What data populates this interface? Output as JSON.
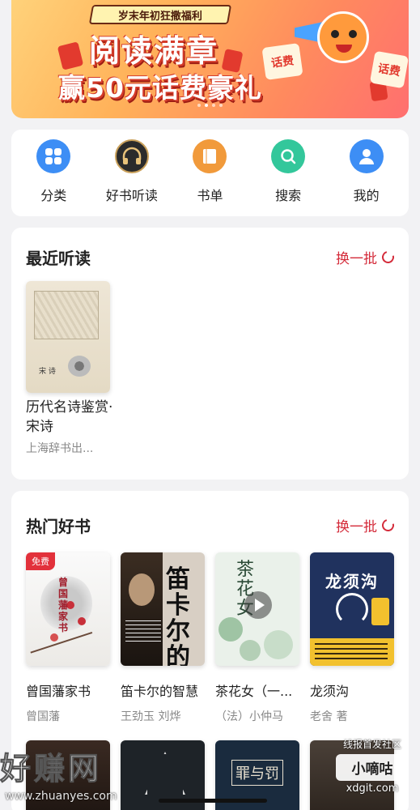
{
  "banner": {
    "ribbon": "岁末年初狂撒福利",
    "title_line1": "阅读满章",
    "title_line2": "赢50元话费豪礼",
    "card_left": "话费",
    "card_right": "话费"
  },
  "nav": [
    {
      "label": "分类",
      "icon": "grid-icon"
    },
    {
      "label": "好书听读",
      "icon": "headphones-icon"
    },
    {
      "label": "书单",
      "icon": "book-icon"
    },
    {
      "label": "搜索",
      "icon": "search-icon"
    },
    {
      "label": "我的",
      "icon": "user-icon"
    }
  ],
  "recent": {
    "title": "最近听读",
    "refresh": "换一批",
    "book": {
      "name": "历代名诗鉴赏·宋诗",
      "publisher": "上海辞书出...",
      "cover_text": "宋 诗"
    }
  },
  "hot": {
    "title": "热门好书",
    "refresh": "换一批",
    "free_badge": "免费",
    "books": [
      {
        "title": "曾国藩家书",
        "author": "曾国藩",
        "cover_text": "曾国藩家书"
      },
      {
        "title": "笛卡尔的智慧",
        "author": "王劲玉 刘烨",
        "cover_text": "笛卡尔的智慧"
      },
      {
        "title": "茶花女（一...",
        "author": "（法）小仲马",
        "cover_text": "茶花女"
      },
      {
        "title": "龙须沟",
        "author": "老舍 著",
        "cover_text": "龙须沟"
      }
    ]
  },
  "watermark": {
    "left_big": "好赚网",
    "left_url": "www.zhuanyes.com",
    "right_top": "线报首发社区",
    "right_mid": "小嘀咕",
    "right_bot": "xdgit.com"
  },
  "colors": {
    "accent": "#d42b3a",
    "blue": "#3d8ef5",
    "orange": "#f19a3b",
    "green": "#33c79b"
  }
}
